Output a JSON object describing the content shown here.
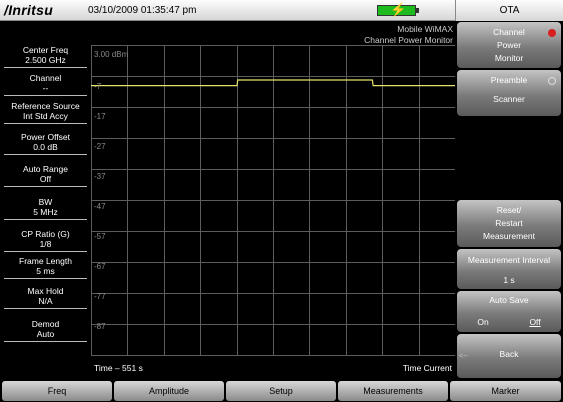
{
  "header": {
    "brand": "/Inritsu",
    "datetime": "03/10/2009 01:35:47 pm"
  },
  "left_panel": [
    {
      "label": "Center Freq",
      "value": "2.500 GHz"
    },
    {
      "label": "Channel",
      "value": "--"
    },
    {
      "label": "Reference Source",
      "value": "Int Std Accy"
    },
    {
      "label": "Power Offset",
      "value": "0.0 dB"
    },
    {
      "label": "Auto Range",
      "value": "Off"
    },
    {
      "label": "BW",
      "value": "5 MHz"
    },
    {
      "label": "CP Ratio (G)",
      "value": "1/8"
    },
    {
      "label": "Frame Length",
      "value": "5 ms"
    },
    {
      "label": "Max Hold",
      "value": "N/A"
    },
    {
      "label": "Demod",
      "value": "Auto"
    }
  ],
  "graph": {
    "mode": "Mobile WiMAX",
    "sub_mode": "Channel Power Monitor",
    "y_top_label": "3.00 dBm",
    "y_labels": [
      "-7",
      "-17",
      "-27",
      "-37",
      "-47",
      "-57",
      "-67",
      "-77",
      "-87"
    ],
    "time_left": "Time – 551 s",
    "time_right": "Time Current"
  },
  "chart_data": {
    "type": "line",
    "title": "",
    "xlabel": "Time",
    "ylabel": "dBm",
    "ylim": [
      -97,
      3
    ],
    "x_range": [
      -551,
      0
    ],
    "grid": true,
    "series": [
      {
        "color": "#e6e26a",
        "x": [
          -551,
          -330,
          -329,
          -125,
          -124,
          0
        ],
        "y": [
          -10.1,
          -10.1,
          -8.3,
          -8.3,
          -10.1,
          -10.1
        ]
      }
    ]
  },
  "right_menu": {
    "title": "OTA",
    "softkeys": {
      "channel_power_monitor": [
        "Channel",
        "Power",
        "Monitor"
      ],
      "preamble_scanner": [
        "Preamble",
        "",
        "Scanner"
      ],
      "reset_restart": [
        "Reset/",
        "Restart",
        "Measurement"
      ],
      "measurement_interval": [
        "Measurement Interval",
        "1 s"
      ],
      "auto_save_label": "Auto Save",
      "auto_save_on": "On",
      "auto_save_off": "Off",
      "back": "Back",
      "back_dash": "<--"
    }
  },
  "bottom_menu": [
    "Freq",
    "Amplitude",
    "Setup",
    "Measurements",
    "Marker"
  ],
  "colors": {
    "trace": "#e6e26a",
    "grid": "#5c5c5c",
    "radio_selected": "#d81f1f",
    "battery": "#1dbb1d"
  }
}
